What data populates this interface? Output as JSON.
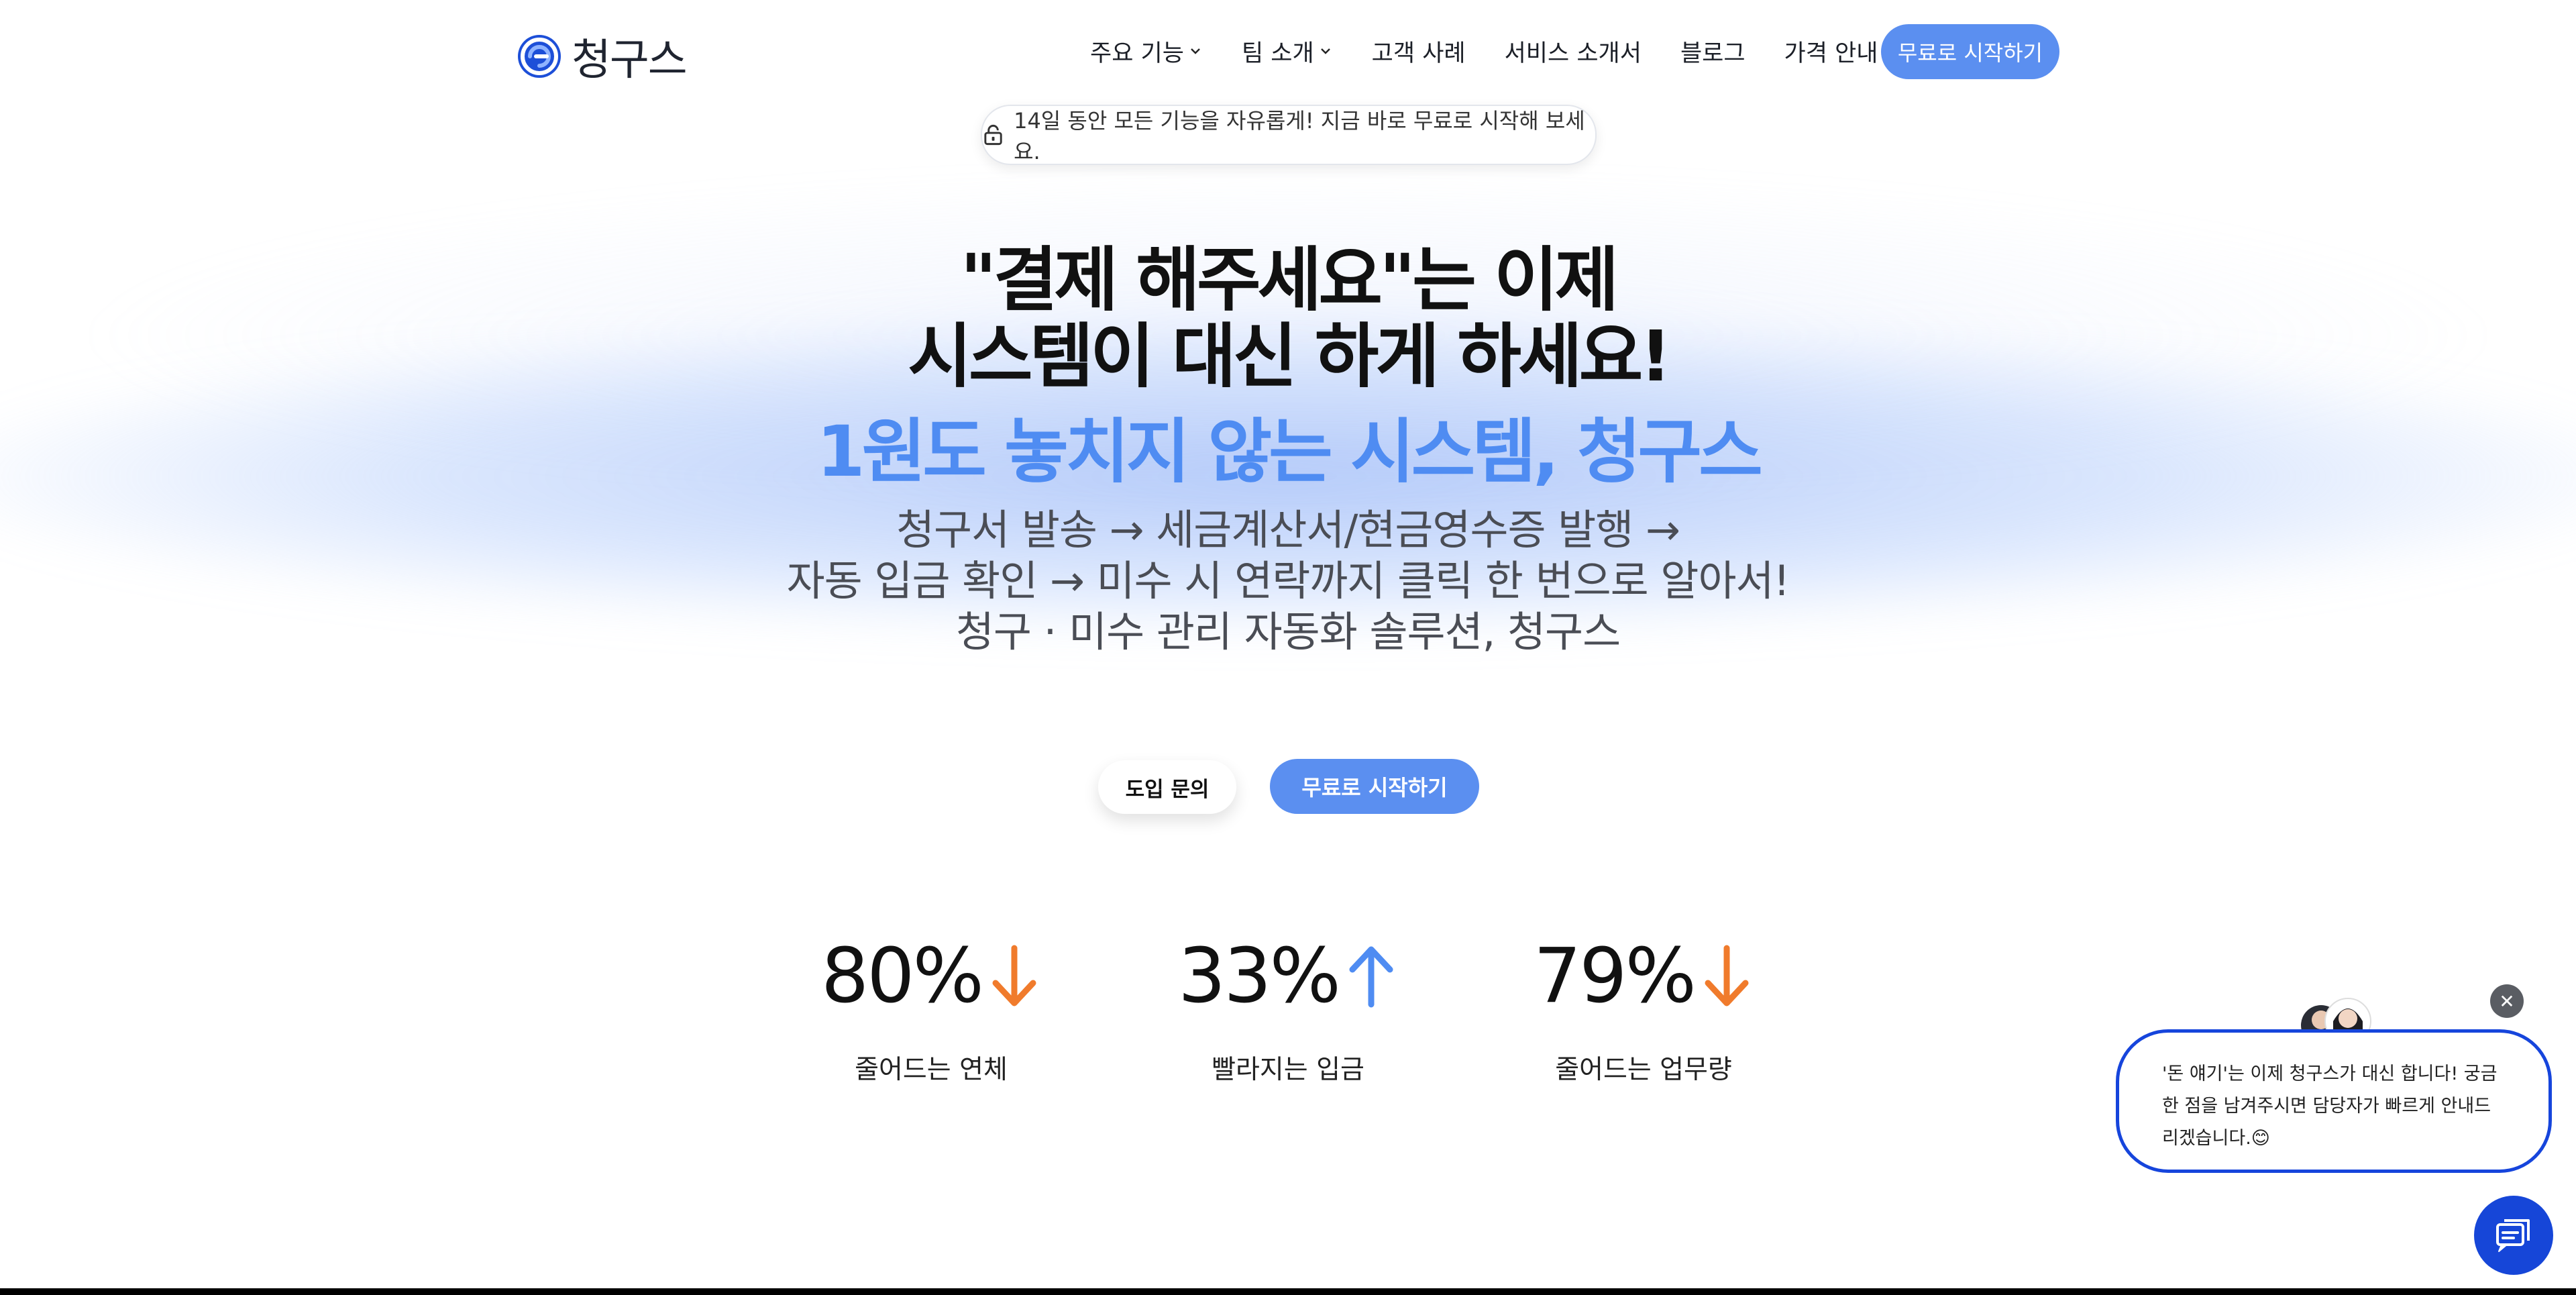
{
  "brand": {
    "name": "청구스",
    "accent_color": "#5b8ff0"
  },
  "nav": {
    "items": [
      {
        "label": "주요 기능",
        "dropdown": true
      },
      {
        "label": "팀 소개",
        "dropdown": true
      },
      {
        "label": "고객 사례",
        "dropdown": false
      },
      {
        "label": "서비스 소개서",
        "dropdown": false
      },
      {
        "label": "블로그",
        "dropdown": false
      },
      {
        "label": "가격 안내",
        "dropdown": false
      }
    ],
    "cta_label": "무료로 시작하기"
  },
  "notice": {
    "text": "14일 동안 모든 기능을 자유롭게! 지금 바로 무료로 시작해 보세요."
  },
  "hero": {
    "title_line1": "\"결제 해주세요\"는 이제",
    "title_line2": "시스템이 대신 하게 하세요!",
    "accent_line": "1원도 놓치지 않는 시스템, 청구스",
    "sub_line1": "청구서 발송 → 세금계산서/현금영수증 발행 →",
    "sub_line2": "자동 입금 확인 → 미수 시 연락까지 클릭 한 번으로 알아서!",
    "sub_line3": "청구 · 미수 관리 자동화 솔루션, 청구스"
  },
  "buttons": {
    "inquiry": "도입 문의",
    "start": "무료로 시작하기"
  },
  "stats": [
    {
      "value": "80%",
      "direction": "down",
      "color": "#f07b2c",
      "label": "줄어드는 연체"
    },
    {
      "value": "33%",
      "direction": "up",
      "color": "#4f8cf2",
      "label": "빨라지는 입금"
    },
    {
      "value": "79%",
      "direction": "down",
      "color": "#f07b2c",
      "label": "줄어드는 업무량"
    }
  ],
  "chat": {
    "message": "'돈 얘기'는 이제 청구스가 대신 합니다! 궁금한 점을 남겨주시면 담당자가 빠르게 안내드리겠습니다.😊",
    "close_icon": "close-icon",
    "fab_icon": "chat-icon",
    "border_color": "#1645dc"
  }
}
